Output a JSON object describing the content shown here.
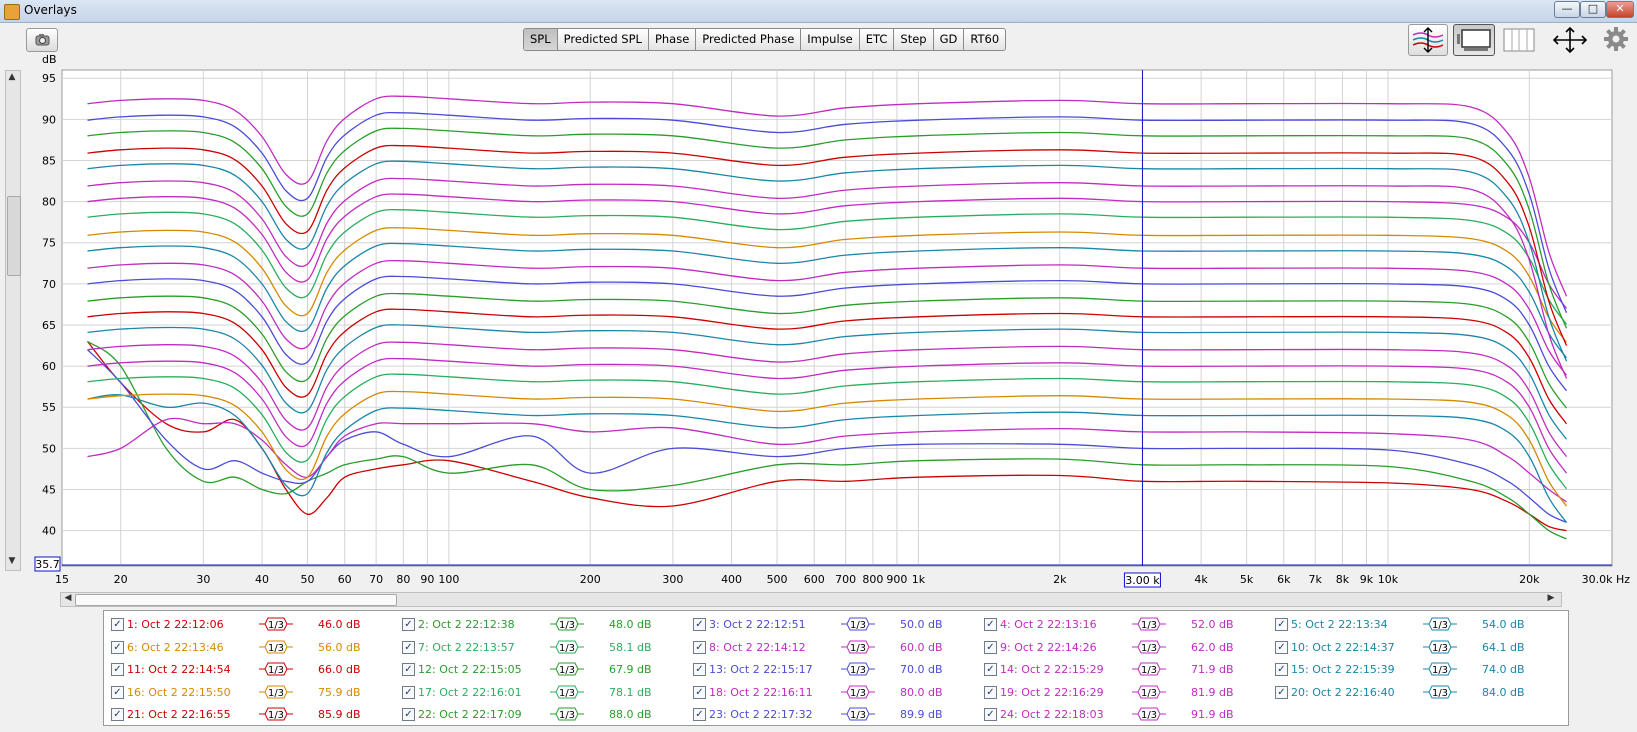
{
  "window": {
    "title": "Overlays",
    "minimize": "—",
    "maximize": "□",
    "close": "✕"
  },
  "toolbar": {
    "tabs": [
      "SPL",
      "Predicted SPL",
      "Phase",
      "Predicted Phase",
      "Impulse",
      "ETC",
      "Step",
      "GD",
      "RT60"
    ],
    "active_tab": "SPL",
    "icons": [
      "camera-icon",
      "stack-traces-icon",
      "display-mode-icon",
      "grid-layout-icon",
      "pan-arrows-icon",
      "gear-icon"
    ]
  },
  "graph": {
    "y_unit": "dB",
    "y_ticks": [
      "95",
      "90",
      "85",
      "80",
      "75",
      "70",
      "65",
      "60",
      "55",
      "50",
      "45",
      "40"
    ],
    "y_cursor_value": "35.7",
    "x_ticks": [
      "15",
      "20",
      "30",
      "40",
      "50",
      "60",
      "70",
      "80",
      "90",
      "100",
      "200",
      "300",
      "400",
      "500",
      "600",
      "700",
      "800",
      "900",
      "1k",
      "2k",
      "3.00 k",
      "4k",
      "5k",
      "6k",
      "7k",
      "8k",
      "9k",
      "10k",
      "20k",
      "30.0k Hz"
    ],
    "cursor_x_label": "3.00 k"
  },
  "chart_data": {
    "type": "line",
    "xlabel": "Hz",
    "ylabel": "dB",
    "xscale": "log",
    "xlim": [
      15,
      30000
    ],
    "ylim": [
      35.7,
      96
    ],
    "x": [
      17,
      20,
      25,
      30,
      35,
      40,
      45,
      50,
      55,
      60,
      70,
      80,
      100,
      150,
      200,
      300,
      500,
      700,
      1000,
      2000,
      3000,
      5000,
      10000,
      15000,
      18000,
      20000,
      22000,
      24000
    ],
    "base_shape": [
      0,
      0.4,
      0.6,
      0.4,
      -0.8,
      -4,
      -8.6,
      -9.5,
      -4.5,
      -1.8,
      0.6,
      0.9,
      0.6,
      0,
      0.2,
      0,
      -1.5,
      -0.5,
      0,
      0.4,
      0,
      0,
      0,
      -0.4,
      -2,
      -5,
      -10,
      -13
    ],
    "series": [
      {
        "name": "1: Oct 2 22:12:06",
        "color": "#cc0000",
        "offset": 46.0,
        "checked": true,
        "smoothing": "1/3",
        "label": "46.0 dB",
        "values": [
          63,
          58,
          53,
          52,
          53.5,
          50,
          45,
          42,
          44,
          46.5,
          47.5,
          48,
          48.5,
          46,
          44,
          43,
          46,
          46,
          46.5,
          46.7,
          46,
          46,
          45.8,
          45,
          43.5,
          42,
          40.5,
          40
        ]
      },
      {
        "name": "2: Oct 2 22:12:38",
        "color": "#2a9d2a",
        "offset": 48.0,
        "checked": true,
        "smoothing": "1/3",
        "label": "48.0 dB",
        "values": [
          63,
          60,
          50,
          46,
          46.5,
          45,
          44.5,
          46,
          47,
          48,
          48.7,
          49,
          47,
          48,
          45,
          45.5,
          48,
          48,
          48.5,
          48.7,
          48,
          48,
          47.8,
          46,
          44,
          42,
          40,
          39
        ]
      },
      {
        "name": "3: Oct 2 22:12:51",
        "color": "#4b4bd8",
        "offset": 50.0,
        "checked": true,
        "smoothing": "1/3",
        "label": "50.0 dB",
        "values": [
          62,
          58,
          51,
          47.5,
          48.5,
          47,
          46,
          46,
          49,
          51,
          52,
          50.5,
          49,
          51.5,
          47,
          50,
          49,
          50,
          50.5,
          50.5,
          50,
          50,
          49.8,
          48,
          46,
          44,
          42,
          41
        ]
      },
      {
        "name": "4: Oct 2 22:13:16",
        "color": "#c02cc0",
        "offset": 52.0,
        "checked": true,
        "smoothing": "1/3",
        "label": "52.0 dB",
        "values": [
          49,
          50,
          53.5,
          53,
          53,
          51,
          48,
          46.5,
          49,
          51.5,
          53,
          53,
          53,
          53,
          52,
          52.5,
          50.5,
          51.5,
          52,
          52.4,
          52,
          52,
          51.8,
          51,
          49,
          47,
          45,
          43.5
        ]
      },
      {
        "name": "5: Oct 2 22:13:34",
        "color": "#1a86a8",
        "offset": 54.0,
        "checked": true,
        "smoothing": "1/3",
        "label": "54.0 dB",
        "values": [
          56,
          56.5,
          55,
          55.5,
          54,
          50,
          45.5,
          44.5,
          49.5,
          52.2,
          54.6,
          54.9,
          54.6,
          54,
          54.2,
          54,
          52.5,
          53.5,
          54,
          54.4,
          54,
          54,
          54,
          53.6,
          52,
          49,
          44,
          41
        ]
      }
    ],
    "curve_colors": [
      "#cc0000",
      "#2a9d2a",
      "#4b4bd8",
      "#c02cc0",
      "#1a86a8",
      "#d48a00",
      "#2aae5e",
      "#c02cc0",
      "#c02cc0",
      "#1a86a8",
      "#cc0000",
      "#2a9d2a",
      "#4b4bd8",
      "#c02cc0",
      "#1a86a8",
      "#d48a00",
      "#2aae5e",
      "#c02cc0",
      "#c02cc0",
      "#1a86a8",
      "#cc0000",
      "#2a9d2a",
      "#4b4bd8",
      "#c02cc0"
    ]
  },
  "legend": {
    "entries": [
      {
        "label": "1: Oct 2 22:12:06",
        "smoothing": "1/3",
        "level": "46.0 dB",
        "color": "#cc0000"
      },
      {
        "label": "2: Oct 2 22:12:38",
        "smoothing": "1/3",
        "level": "48.0 dB",
        "color": "#2a9d2a"
      },
      {
        "label": "3: Oct 2 22:12:51",
        "smoothing": "1/3",
        "level": "50.0 dB",
        "color": "#4b4bd8"
      },
      {
        "label": "4: Oct 2 22:13:16",
        "smoothing": "1/3",
        "level": "52.0 dB",
        "color": "#c02cc0"
      },
      {
        "label": "5: Oct 2 22:13:34",
        "smoothing": "1/3",
        "level": "54.0 dB",
        "color": "#1a86a8"
      },
      {
        "label": "6: Oct 2 22:13:46",
        "smoothing": "1/3",
        "level": "56.0 dB",
        "color": "#d48a00"
      },
      {
        "label": "7: Oct 2 22:13:57",
        "smoothing": "1/3",
        "level": "58.1 dB",
        "color": "#2aae5e"
      },
      {
        "label": "8: Oct 2 22:14:12",
        "smoothing": "1/3",
        "level": "60.0 dB",
        "color": "#c02cc0"
      },
      {
        "label": "9: Oct 2 22:14:26",
        "smoothing": "1/3",
        "level": "62.0 dB",
        "color": "#c02cc0"
      },
      {
        "label": "10: Oct 2 22:14:37",
        "smoothing": "1/3",
        "level": "64.1 dB",
        "color": "#1a86a8"
      },
      {
        "label": "11: Oct 2 22:14:54",
        "smoothing": "1/3",
        "level": "66.0 dB",
        "color": "#cc0000"
      },
      {
        "label": "12: Oct 2 22:15:05",
        "smoothing": "1/3",
        "level": "67.9 dB",
        "color": "#2a9d2a"
      },
      {
        "label": "13: Oct 2 22:15:17",
        "smoothing": "1/3",
        "level": "70.0 dB",
        "color": "#4b4bd8"
      },
      {
        "label": "14: Oct 2 22:15:29",
        "smoothing": "1/3",
        "level": "71.9 dB",
        "color": "#c02cc0"
      },
      {
        "label": "15: Oct 2 22:15:39",
        "smoothing": "1/3",
        "level": "74.0 dB",
        "color": "#1a86a8"
      },
      {
        "label": "16: Oct 2 22:15:50",
        "smoothing": "1/3",
        "level": "75.9 dB",
        "color": "#d48a00"
      },
      {
        "label": "17: Oct 2 22:16:01",
        "smoothing": "1/3",
        "level": "78.1 dB",
        "color": "#2aae5e"
      },
      {
        "label": "18: Oct 2 22:16:11",
        "smoothing": "1/3",
        "level": "80.0 dB",
        "color": "#c02cc0"
      },
      {
        "label": "19: Oct 2 22:16:29",
        "smoothing": "1/3",
        "level": "81.9 dB",
        "color": "#c02cc0"
      },
      {
        "label": "20: Oct 2 22:16:40",
        "smoothing": "1/3",
        "level": "84.0 dB",
        "color": "#1a86a8"
      },
      {
        "label": "21: Oct 2 22:16:55",
        "smoothing": "1/3",
        "level": "85.9 dB",
        "color": "#cc0000"
      },
      {
        "label": "22: Oct 2 22:17:09",
        "smoothing": "1/3",
        "level": "88.0 dB",
        "color": "#2a9d2a"
      },
      {
        "label": "23: Oct 2 22:17:32",
        "smoothing": "1/3",
        "level": "89.9 dB",
        "color": "#4b4bd8"
      },
      {
        "label": "24: Oct 2 22:18:03",
        "smoothing": "1/3",
        "level": "91.9 dB",
        "color": "#c02cc0"
      }
    ]
  }
}
